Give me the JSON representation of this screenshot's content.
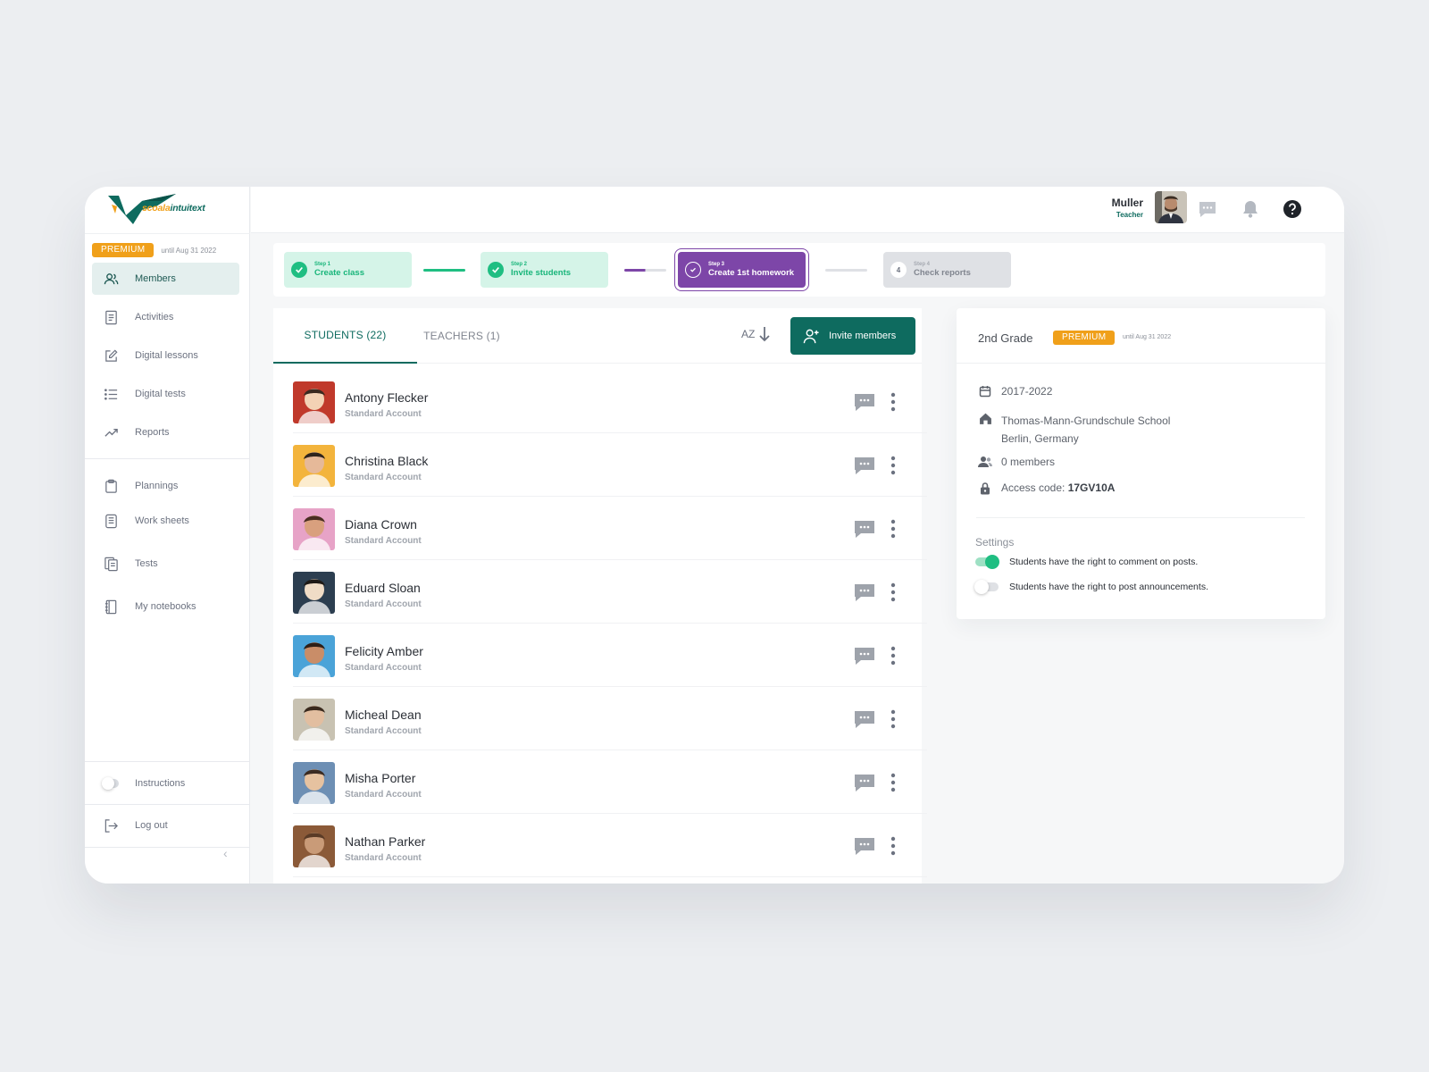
{
  "brand": {
    "logo_name": "scoala",
    "logo_suffix": "intuitext"
  },
  "plan": {
    "badge": "PREMIUM",
    "until": "until Aug 31 2022"
  },
  "sidebar": {
    "items": [
      {
        "label": "Members",
        "icon": "users-icon"
      },
      {
        "label": "Activities",
        "icon": "document-icon"
      },
      {
        "label": "Digital lessons",
        "icon": "edit-icon"
      },
      {
        "label": "Digital tests",
        "icon": "list-icon"
      },
      {
        "label": "Reports",
        "icon": "trend-icon"
      },
      {
        "label": "Plannings",
        "icon": "clipboard-icon"
      },
      {
        "label": "Work sheets",
        "icon": "sheet-icon"
      },
      {
        "label": "Tests",
        "icon": "files-icon"
      },
      {
        "label": "My notebooks",
        "icon": "notebook-icon"
      }
    ],
    "instructions": "Instructions",
    "logout": "Log out"
  },
  "topbar": {
    "user_name": "Muller",
    "user_role": "Teacher"
  },
  "stepper": {
    "steps": [
      {
        "step": "Step 1",
        "label": "Create class",
        "state": "done"
      },
      {
        "step": "Step 2",
        "label": "Invite students",
        "state": "done"
      },
      {
        "step": "Step 3",
        "label": "Create 1st homework",
        "state": "current"
      },
      {
        "step": "Step 4",
        "label": "Check reports",
        "state": "todo",
        "number": "4"
      }
    ]
  },
  "members": {
    "tabs": [
      "STUDENTS (22)",
      "TEACHERS (1)"
    ],
    "sort_label": "AZ",
    "invite_label": "Invite members",
    "students": [
      {
        "name": "Antony Flecker",
        "account": "Standard Account"
      },
      {
        "name": "Christina Black",
        "account": "Standard Account"
      },
      {
        "name": "Diana Crown",
        "account": "Standard Account"
      },
      {
        "name": "Eduard Sloan",
        "account": "Standard Account"
      },
      {
        "name": "Felicity Amber",
        "account": "Standard Account"
      },
      {
        "name": "Micheal Dean",
        "account": "Standard Account"
      },
      {
        "name": "Misha Porter",
        "account": "Standard Account"
      },
      {
        "name": "Nathan Parker",
        "account": "Standard Account"
      }
    ]
  },
  "class_info": {
    "grade": "2nd Grade",
    "badge": "PREMIUM",
    "until": "until Aug 31 2022",
    "years": "2017-2022",
    "school": "Thomas-Mann-Grundschule School",
    "location": "Berlin, Germany",
    "members": "0 members",
    "access_label": "Access code: ",
    "access_code": "17GV10A",
    "settings_title": "Settings",
    "settings": [
      {
        "label": "Students have the right to comment on posts.",
        "on": true
      },
      {
        "label": "Students have the right to post announcements.",
        "on": false
      }
    ]
  },
  "colors": {
    "brand": "#0e6b5f",
    "premium": "#f0a01a",
    "step_done": "#1fbe82",
    "step_current": "#7d46a8"
  }
}
